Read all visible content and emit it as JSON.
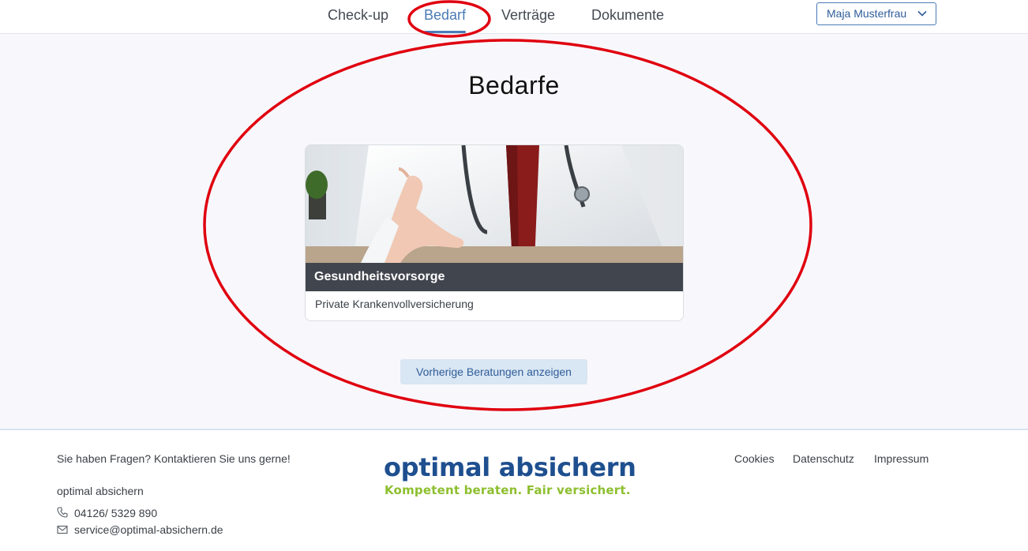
{
  "nav": {
    "items": [
      {
        "label": "Check-up"
      },
      {
        "label": "Bedarf"
      },
      {
        "label": "Verträge"
      },
      {
        "label": "Dokumente"
      }
    ],
    "active": "Bedarf"
  },
  "user_menu": {
    "label": "Maja Musterfrau",
    "icon": "chevron-down-icon"
  },
  "main": {
    "title": "Bedarfe",
    "card": {
      "category": "Gesundheitsvorsorge",
      "subtitle": "Private Krankenvollversicherung",
      "image": "doctor-handshake-photo"
    },
    "previous_button": "Vorherige Beratungen anzeigen"
  },
  "footer": {
    "question": "Sie haben Fragen?  Kontaktieren Sie uns gerne!",
    "company": "optimal absichern",
    "phone": "04126/ 5329 890",
    "email": "service@optimal-absichern.de",
    "logo_text": "optimal absichern",
    "logo_tagline": "Kompetent beraten. Fair versichert.",
    "links": [
      "Cookies",
      "Datenschutz",
      "Impressum"
    ]
  },
  "colors": {
    "accent": "#4a7bb7",
    "band": "#41454d",
    "logo_blue": "#1e4f8f",
    "logo_green": "#8dbf2f",
    "annotation_red": "#e0000f"
  }
}
